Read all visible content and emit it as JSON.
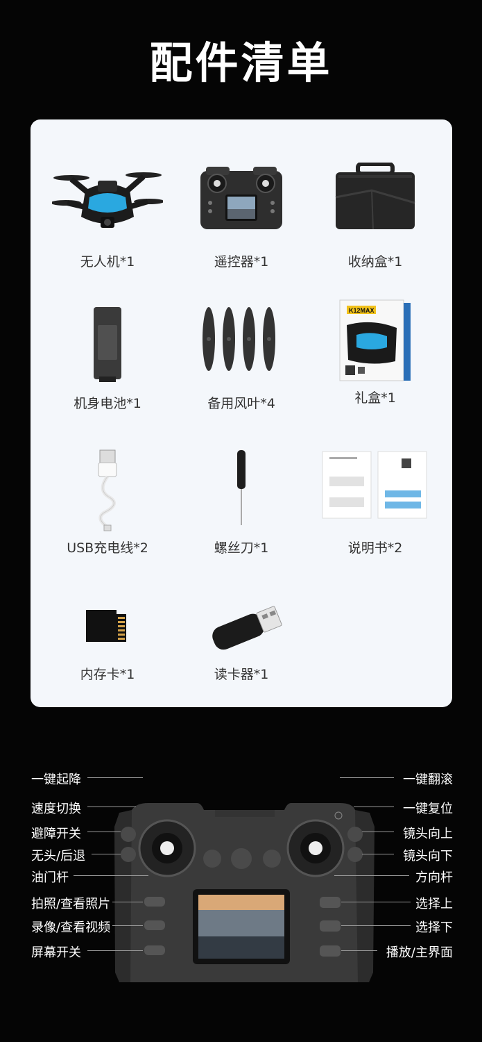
{
  "title": "配件清单",
  "items": [
    {
      "label": "无人机*1",
      "icon": "drone-icon"
    },
    {
      "label": "遥控器*1",
      "icon": "remote-controller-icon"
    },
    {
      "label": "收纳盒*1",
      "icon": "storage-case-icon"
    },
    {
      "label": "机身电池*1",
      "icon": "battery-icon"
    },
    {
      "label": "备用风叶*4",
      "icon": "propeller-icon"
    },
    {
      "label": "礼盒*1",
      "icon": "gift-box-icon"
    },
    {
      "label": "USB充电线*2",
      "icon": "usb-cable-icon"
    },
    {
      "label": "螺丝刀*1",
      "icon": "screwdriver-icon"
    },
    {
      "label": "说明书*2",
      "icon": "manual-icon"
    },
    {
      "label": "内存卡*1",
      "icon": "memory-card-icon"
    },
    {
      "label": "读卡器*1",
      "icon": "card-reader-icon"
    }
  ],
  "gift_box_brand": "K12MAX",
  "controller": {
    "left_labels": [
      "一键起降",
      "速度切换",
      "避障开关",
      "无头/后退",
      "油门杆",
      "拍照/查看照片",
      "录像/查看视频",
      "屏幕开关"
    ],
    "right_labels": [
      "一键翻滚",
      "一键复位",
      "镜头向上",
      "镜头向下",
      "方向杆",
      "选择上",
      "选择下",
      "播放/主界面"
    ]
  },
  "colors": {
    "background": "#050505",
    "card": "#f4f7fb",
    "accent_blue": "#2aa8e0"
  }
}
